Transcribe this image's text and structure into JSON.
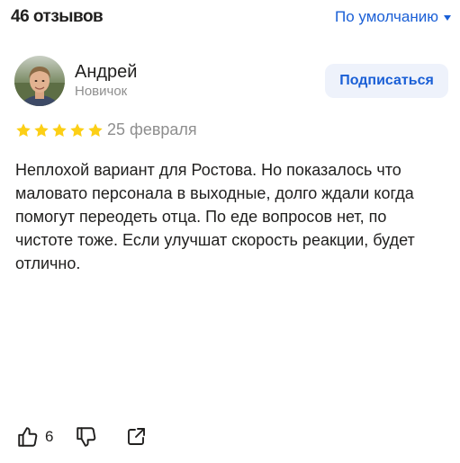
{
  "header": {
    "review_count": "46 отзывов",
    "sort_label": "По умолчанию"
  },
  "review": {
    "author": {
      "name": "Андрей",
      "level": "Новичок"
    },
    "subscribe_label": "Подписаться",
    "rating": 5,
    "rating_max": 5,
    "date": "25 февраля",
    "text": "Неплохой вариант для Ростова. Но показалось что маловато персонала в выходные, долго ждали когда помогут переодеть отца. По еде вопросов нет, по чистоте тоже. Если улучшат скорость реакции, будет отлично.",
    "likes": "6"
  },
  "colors": {
    "accent": "#1a5fd6",
    "star": "#fccf16",
    "muted": "#8e8e8e",
    "text": "#21201f",
    "subscribe_bg": "#eef2fb"
  },
  "icons": {
    "sort": "caret-down-icon",
    "like": "thumbs-up-icon",
    "dislike": "thumbs-down-icon",
    "share": "share-icon",
    "star": "star-icon"
  }
}
